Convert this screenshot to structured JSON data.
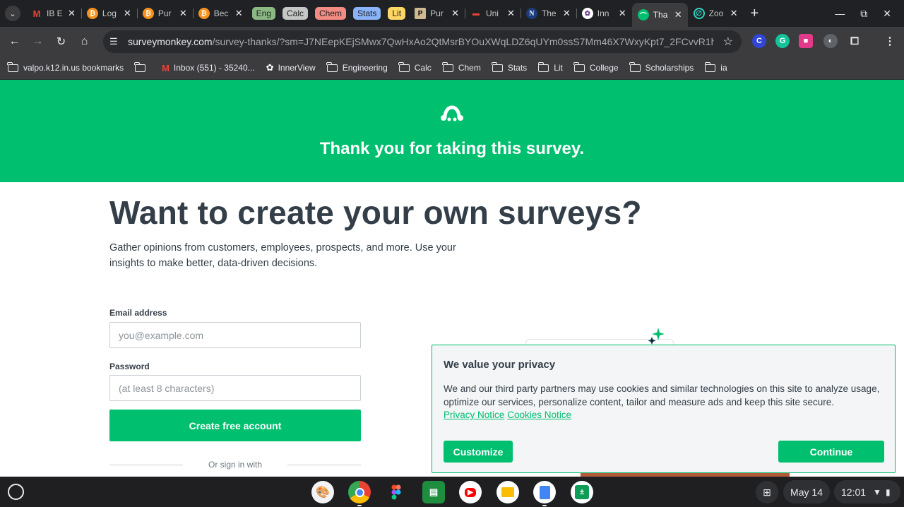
{
  "browser": {
    "tabs": [
      {
        "title": "IB E",
        "favicon": "gmail-icon"
      },
      {
        "title": "Log",
        "favicon": "bitcoin-icon"
      },
      {
        "title": "Pur",
        "favicon": "bitcoin-icon"
      },
      {
        "title": "Bec",
        "favicon": "bitcoin-icon"
      }
    ],
    "tab_groups": [
      {
        "label": "Eng",
        "color": "#8ab984"
      },
      {
        "label": "Calc",
        "color": "#c4c7c5"
      },
      {
        "label": "Chem",
        "color": "#f28b82"
      },
      {
        "label": "Stats",
        "color": "#8ab4f8"
      },
      {
        "label": "Lit",
        "color": "#fdd663"
      }
    ],
    "tabs_after": [
      {
        "title": "Pur",
        "favicon": "purdue-icon"
      },
      {
        "title": "Uni",
        "favicon": "dash-icon"
      },
      {
        "title": "The",
        "favicon": "n-icon"
      },
      {
        "title": "Inn",
        "favicon": "innerview-icon"
      },
      {
        "title": "Tha",
        "favicon": "surveymonkey-icon",
        "active": true
      },
      {
        "title": "Zoo",
        "favicon": "zoom-icon"
      }
    ],
    "url_host": "surveymonkey.com",
    "url_path": "/survey-thanks/?sm=J7NEepKEjSMwx7QwHxAo2QtMsrBYOuXWqLDZ6qUYm0ssS7Mm46X7WxyKpt7_2FCvvR1hc_2BrnI...",
    "bookmarks": [
      {
        "label": "valpo.k12.in.us bookmarks",
        "icon": "folder-managed-icon"
      },
      {
        "label": "",
        "icon": "folder-icon"
      },
      {
        "label": "Inbox (551) - 35240...",
        "icon": "gmail-icon"
      },
      {
        "label": "InnerView",
        "icon": "innerview-icon"
      },
      {
        "label": "Engineering",
        "icon": "folder-icon"
      },
      {
        "label": "Calc",
        "icon": "folder-icon"
      },
      {
        "label": "Chem",
        "icon": "folder-icon"
      },
      {
        "label": "Stats",
        "icon": "folder-icon"
      },
      {
        "label": "Lit",
        "icon": "folder-icon"
      },
      {
        "label": "College",
        "icon": "folder-icon"
      },
      {
        "label": "Scholarships",
        "icon": "folder-icon"
      },
      {
        "label": "ia",
        "icon": "folder-icon"
      }
    ]
  },
  "page": {
    "hero_title": "Thank you for taking this survey.",
    "heading": "Want to create your own surveys?",
    "subtext": "Gather opinions from customers, employees, prospects, and more. Use your insights to make better, data-driven decisions.",
    "email_label": "Email address",
    "email_placeholder": "you@example.com",
    "password_label": "Password",
    "password_placeholder": "(at least 8 characters)",
    "create_button": "Create free account",
    "or_sign_in": "Or sign in with",
    "brand_color": "#00bf6f"
  },
  "privacy": {
    "title": "We value your privacy",
    "body": "We and our third party partners may use cookies and similar technologies on this site to analyze usage, optimize our services, personalize content, tailor and measure ads and keep this site secure.",
    "privacy_link": "Privacy Notice",
    "cookies_link": "Cookies Notice",
    "customize": "Customize",
    "continue": "Continue"
  },
  "shelf": {
    "apps": [
      "paint-icon",
      "chrome-icon",
      "figma-icon",
      "classroom-icon",
      "youtube-icon",
      "slides-icon",
      "docs-icon",
      "calculator-icon"
    ],
    "date": "May 14",
    "time": "12:01"
  }
}
